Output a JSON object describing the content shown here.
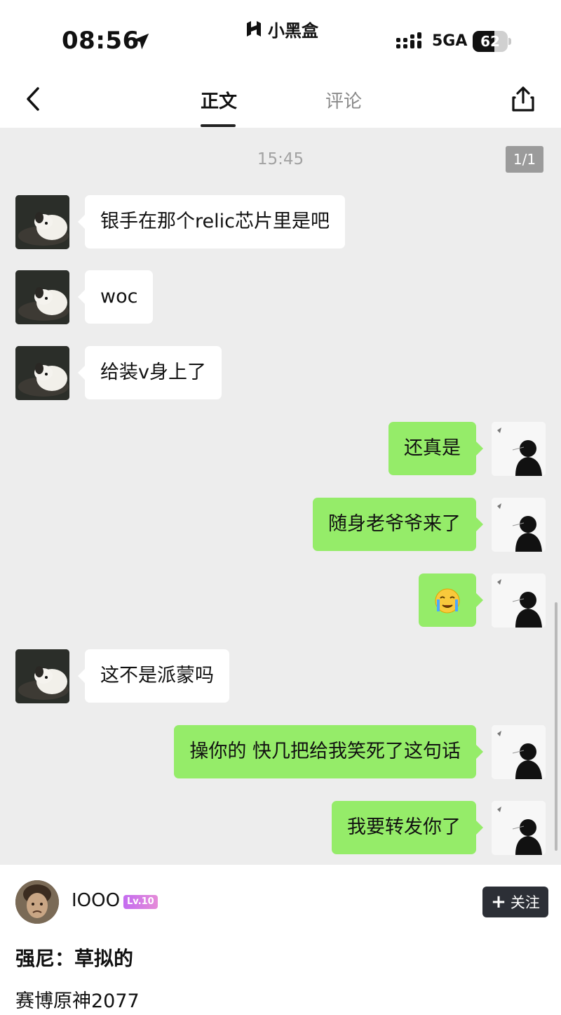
{
  "status_bar": {
    "time": "08:56",
    "app_name": "小黑盒",
    "network": "5GA",
    "battery_percent": 62,
    "battery_label": "62"
  },
  "nav": {
    "back_icon": "chevron-left-icon",
    "tabs": [
      {
        "label": "正文",
        "active": true
      },
      {
        "label": "评论",
        "active": false
      }
    ],
    "share_icon": "share-icon"
  },
  "chat": {
    "timestamp": "15:45",
    "page_indicator": "1/1",
    "messages": [
      {
        "side": "in",
        "text": "银手在那个relic芯片里是吧"
      },
      {
        "side": "in",
        "text": "woc"
      },
      {
        "side": "in",
        "text": "给装v身上了"
      },
      {
        "side": "out",
        "text": "还真是"
      },
      {
        "side": "out",
        "text": "随身老爷爷来了"
      },
      {
        "side": "out",
        "text": "",
        "emoji": "crying-face-emoji"
      },
      {
        "side": "in",
        "text": "这不是派蒙吗"
      },
      {
        "side": "out",
        "text": "操你的 快几把给我笑死了这句话"
      },
      {
        "side": "out",
        "text": "我要转发你了"
      }
    ]
  },
  "author": {
    "name": "IOOO",
    "level": "Lv.10",
    "follow_label": "关注"
  },
  "post": {
    "title": "强尼：草拟的",
    "body": "赛博原神2077"
  },
  "colors": {
    "chat_background": "#ededed",
    "outgoing_bubble": "#95ec69",
    "incoming_bubble": "#ffffff",
    "follow_button": "#2c2f36"
  }
}
